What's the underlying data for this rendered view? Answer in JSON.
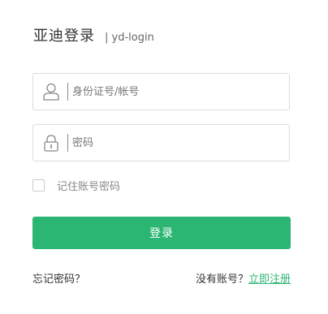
{
  "header": {
    "title": "亚迪登录",
    "subtitle": "| yd-login"
  },
  "form": {
    "account": {
      "placeholder": "身份证号/帐号",
      "value": "",
      "icon": "user-icon"
    },
    "password": {
      "placeholder": "密码",
      "value": "",
      "icon": "lock-icon"
    },
    "remember": {
      "label": "记住账号密码",
      "checked": false
    },
    "submit_label": "登录"
  },
  "footer": {
    "forgot_label": "忘记密码？",
    "no_account_label": "没有账号？",
    "register_label": "立即注册"
  },
  "colors": {
    "accent": "#2bb673",
    "border": "#dcdcdc",
    "muted_text": "#888888"
  }
}
